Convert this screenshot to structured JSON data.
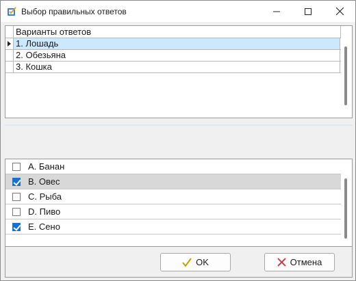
{
  "window": {
    "title": "Выбор правильных ответов",
    "minimize_glyph": "minimize",
    "maximize_glyph": "maximize",
    "close_glyph": "close"
  },
  "answers_grid": {
    "column_header": "Варианты ответов",
    "rows": [
      {
        "label": "1. Лошадь",
        "selected": true
      },
      {
        "label": "2. Обезьяна",
        "selected": false
      },
      {
        "label": "3. Кошка",
        "selected": false
      }
    ]
  },
  "options": {
    "items": [
      {
        "label": "A. Банан",
        "checked": false,
        "highlighted": false
      },
      {
        "label": "B. Овес",
        "checked": true,
        "highlighted": true
      },
      {
        "label": "C. Рыба",
        "checked": false,
        "highlighted": false
      },
      {
        "label": "D. Пиво",
        "checked": false,
        "highlighted": false
      },
      {
        "label": "E. Сено",
        "checked": true,
        "highlighted": false
      }
    ]
  },
  "footer": {
    "ok_label": "OK",
    "cancel_label": "Отмена"
  },
  "colors": {
    "selection": "#cce8ff",
    "highlight_row": "#d8d8d8",
    "checkbox_checked": "#1a6fd0",
    "ok_icon": "#c8a000",
    "cancel_icon": "#d04040"
  },
  "icons": {
    "app": "app-icon",
    "ok": "check-icon",
    "cancel": "x-icon"
  }
}
